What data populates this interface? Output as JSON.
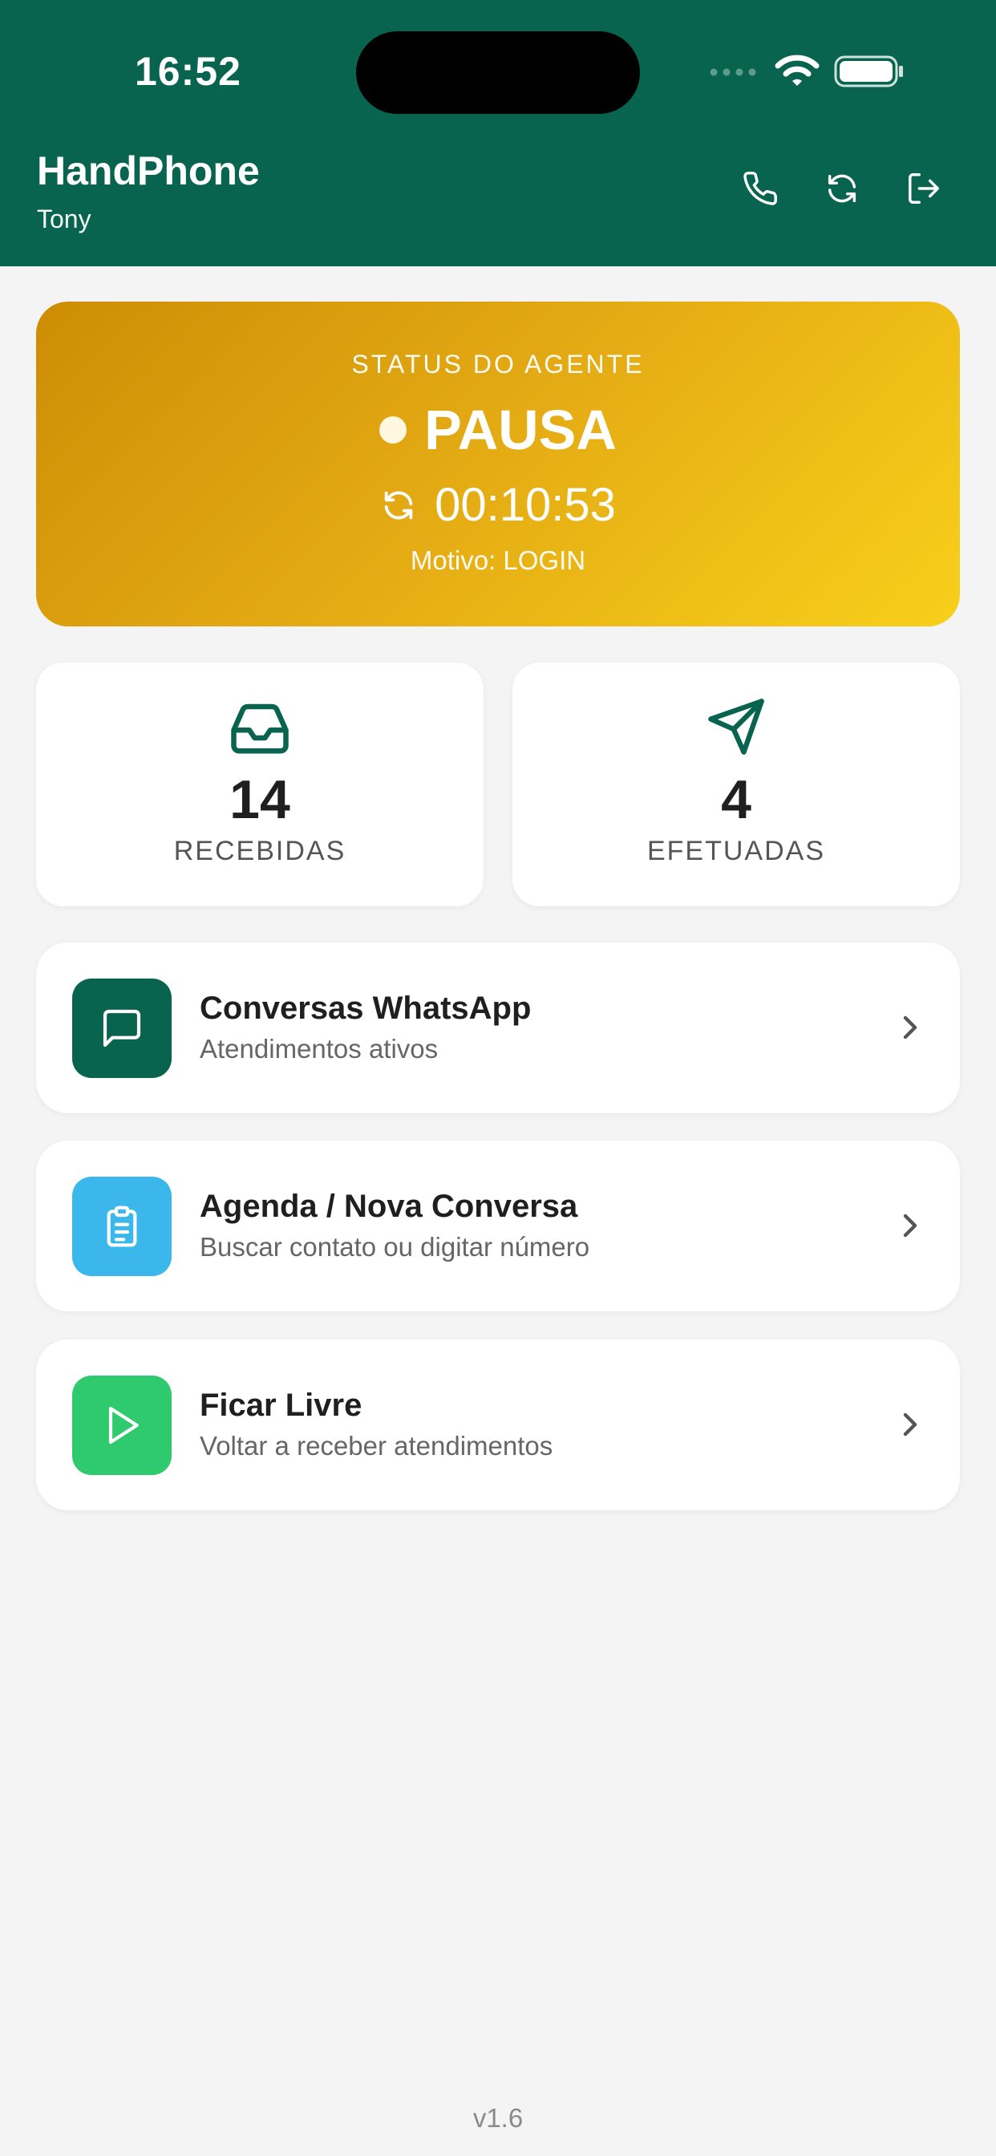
{
  "statusbar": {
    "time": "16:52"
  },
  "header": {
    "title": "HandPhone",
    "user": "Tony"
  },
  "header_actions": [
    "phone-icon",
    "refresh-icon",
    "logout-icon"
  ],
  "status_card": {
    "label": "STATUS DO AGENTE",
    "state": "PAUSA",
    "timer": "00:10:53",
    "reason": "Motivo: LOGIN"
  },
  "counters": [
    {
      "icon": "inbox-icon",
      "value": "14",
      "label": "RECEBIDAS"
    },
    {
      "icon": "send-icon",
      "value": "4",
      "label": "EFETUADAS"
    }
  ],
  "menu": [
    {
      "icon": "chat-icon",
      "title": "Conversas WhatsApp",
      "subtitle": "Atendimentos ativos",
      "color": "#08634f"
    },
    {
      "icon": "clipboard-icon",
      "title": "Agenda / Nova Conversa",
      "subtitle": "Buscar contato ou digitar número",
      "color": "#3bb7ec"
    },
    {
      "icon": "play-icon",
      "title": "Ficar Livre",
      "subtitle": "Voltar a receber atendimentos",
      "color": "#2fca6d"
    }
  ],
  "version": "v1.6",
  "colors": {
    "header": "#08634f",
    "status_gradient_start": "#cc8d05",
    "status_gradient_end": "#f8cf1a",
    "background": "#f4f4f4"
  }
}
